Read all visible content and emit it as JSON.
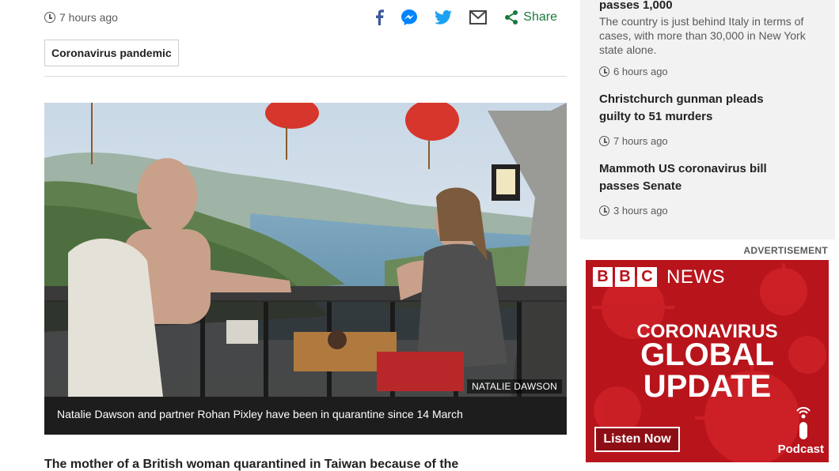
{
  "article": {
    "time": "7 hours ago",
    "share_label": "Share",
    "tag": "Coronavirus pandemic",
    "photo_credit": "NATALIE DAWSON",
    "caption": "Natalie Dawson and partner Rohan Pixley have been in quarantine since 14 March",
    "lede": "The mother of a British woman quarantined in Taiwan because of the"
  },
  "sidebar": {
    "items": [
      {
        "title": "passes 1,000",
        "summary": "The country is just behind Italy in terms of cases, with more than 30,000 in New York state alone.",
        "time": "6 hours ago"
      },
      {
        "title_line1": "Christchurch gunman pleads",
        "title_line2": "guilty to 51 murders",
        "time": "7 hours ago"
      },
      {
        "title_line1": "Mammoth US coronavirus bill",
        "title_line2": "passes Senate",
        "time": "3 hours ago"
      }
    ]
  },
  "ad": {
    "label": "ADVERTISEMENT",
    "logo_letters": [
      "B",
      "B",
      "C"
    ],
    "news_word": "NEWS",
    "line1": "CORONAVIRUS",
    "line2": "GLOBAL",
    "line3": "UPDATE",
    "button": "Listen Now",
    "podcast": "Podcast"
  },
  "colors": {
    "share_green": "#1a7a3c",
    "facebook": "#3b5998",
    "messenger": "#0084ff",
    "twitter": "#1da1f2",
    "ad_red": "#b8141c"
  },
  "icons": [
    "clock-icon",
    "facebook-icon",
    "messenger-icon",
    "twitter-icon",
    "email-icon",
    "share-icon",
    "microphone-icon"
  ]
}
